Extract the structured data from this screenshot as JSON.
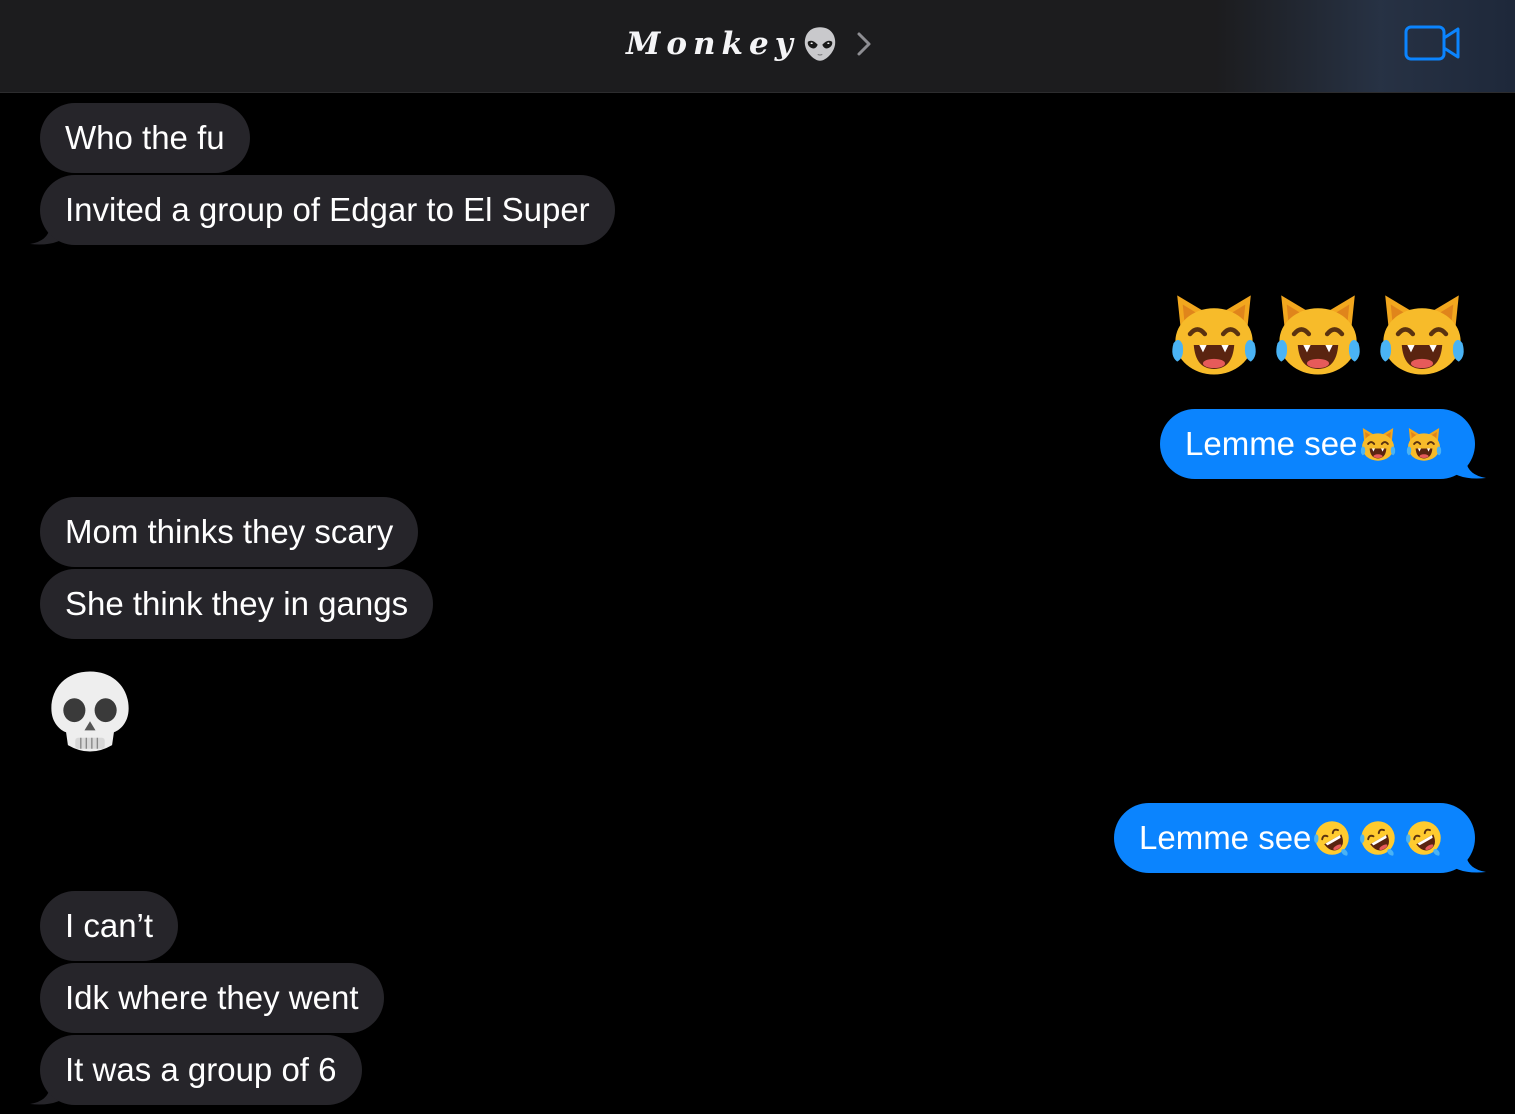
{
  "header": {
    "contact_name": "Monkey",
    "contact_emoji": "alien-emoji",
    "chevron_icon": "chevron-right-icon",
    "video_icon": "video-camera-icon",
    "accent_color": "#0b84fe"
  },
  "messages": [
    {
      "direction": "received",
      "text": "Who the fu"
    },
    {
      "direction": "received",
      "text": "Invited a group of Edgar to El Super"
    },
    {
      "direction": "sent",
      "emoji_only": [
        "cat-tears-of-joy",
        "cat-tears-of-joy",
        "cat-tears-of-joy"
      ]
    },
    {
      "direction": "sent",
      "text": "Lemme see",
      "emojis": [
        "cat-tears-of-joy",
        "cat-tears-of-joy"
      ]
    },
    {
      "direction": "received",
      "text": "Mom thinks they scary"
    },
    {
      "direction": "received",
      "text": "She think they in gangs"
    },
    {
      "direction": "received",
      "emoji_only": [
        "skull"
      ]
    },
    {
      "direction": "sent",
      "text": "Lemme see",
      "emojis": [
        "rolling-on-floor-laughing",
        "rolling-on-floor-laughing",
        "rolling-on-floor-laughing"
      ]
    },
    {
      "direction": "received",
      "text": "I can’t"
    },
    {
      "direction": "received",
      "text": "Idk where they went"
    },
    {
      "direction": "received",
      "text": "It was a group of 6"
    }
  ],
  "colors": {
    "received_bubble": "#26252a",
    "sent_bubble": "#0b84fe",
    "background": "#000000",
    "header": "#1c1c1e"
  }
}
